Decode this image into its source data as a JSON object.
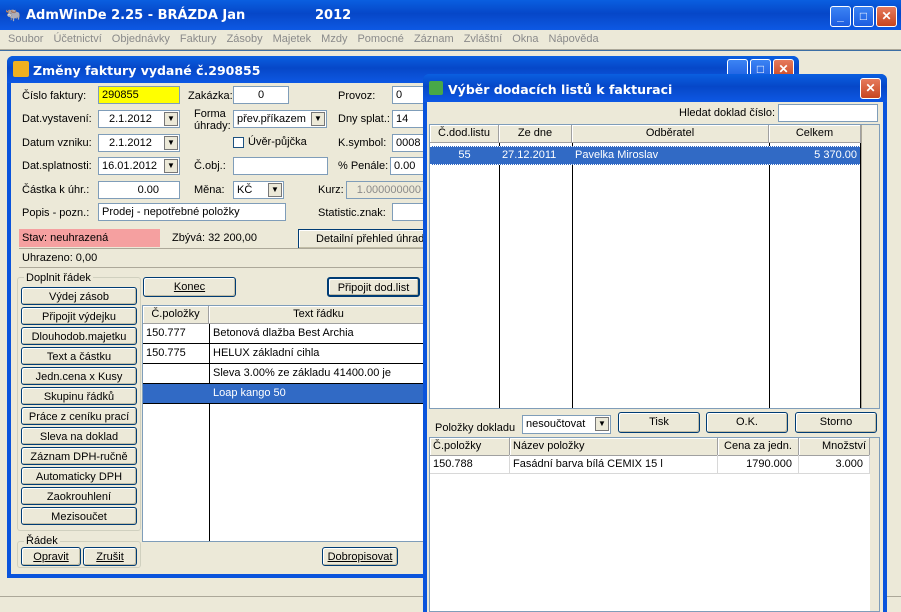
{
  "app": {
    "title": "AdmWinDe 2.25 - BRÁZDA Jan",
    "year": "2012"
  },
  "menu": [
    "Soubor",
    "Účetnictví",
    "Objednávky",
    "Faktury",
    "Zásoby",
    "Majetek",
    "Mzdy",
    "Pomocné",
    "Záznam",
    "Zvláštní",
    "Okna",
    "Nápověda"
  ],
  "invoice": {
    "title": "Změny faktury vydané č.290855",
    "cislo_label": "Číslo faktury:",
    "cislo": "290855",
    "zakazka_label": "Zakázka:",
    "zakazka": "0",
    "provoz_label": "Provoz:",
    "provoz": "0",
    "dat_vystaveni_label": "Dat.vystavení:",
    "dat_vystaveni": "2.1.2012",
    "forma_label1": "Forma",
    "forma_label2": "úhrady:",
    "forma": "přev.příkazem",
    "dny_label": "Dny splat.:",
    "dny": "14",
    "datum_vzniku_label": "Datum vzniku:",
    "datum_vzniku": "2.1.2012",
    "uver_label": "Úvěr-půjčka",
    "ksymbol_label": "K.symbol:",
    "ksymbol": "0008",
    "dat_splatnosti_label": "Dat.splatnosti:",
    "dat_splatnosti": "16.01.2012",
    "cobj_label": "Č.obj.:",
    "cobj": "",
    "penale_label": "% Penále:",
    "penale": "0.00",
    "castka_label": "Částka k úhr.:",
    "castka": "0.00",
    "mena_label": "Měna:",
    "mena": "KČ",
    "kurz_label": "Kurz:",
    "kurz": "1.000000000",
    "popis_label": "Popis - pozn.:",
    "popis": "Prodej - nepotřebné položky",
    "statistic_label": "Statistic.znak:",
    "statistic": "",
    "stav": "Stav: neuhrazená",
    "zbyva": "Zbývá: 32 200,00",
    "detail_btn": "Detailní přehled úhrad",
    "uhrazeno": "Uhrazeno: 0,00",
    "doplnit_title": "Doplnit řádek",
    "left_buttons": [
      "Výdej zásob",
      "Připojit výdejku",
      "Dlouhodob.majetku",
      "Text a částku",
      "Jedn.cena x Kusy",
      "Skupinu řádků",
      "Práce z ceníku prací",
      "Sleva na doklad",
      "Záznam DPH-ručně",
      "Automaticky DPH",
      "Zaokrouhlení",
      "Mezisoučet"
    ],
    "radek_title": "Řádek",
    "opravit": "Opravit",
    "zrusit": "Zrušit",
    "konec": "Konec",
    "pripojit_dl": "Připojit dod.list",
    "dobropisovat": "Dobropisovat",
    "grid_headers": [
      "Č.položky",
      "Text řádku"
    ],
    "grid_rows": [
      {
        "cislo": "150.777",
        "text": "Betonová dlažba Best Archia"
      },
      {
        "cislo": "150.775",
        "text": "HELUX základní cihla"
      },
      {
        "cislo": "",
        "text": "Sleva  3.00% ze základu  41400.00 je"
      },
      {
        "cislo": "",
        "text": "Loap kango 50"
      }
    ]
  },
  "dialog": {
    "title": "Výběr dodacích listů k fakturaci",
    "hledat_label": "Hledat doklad číslo:",
    "hledat": "",
    "headers": [
      "Č.dod.listu",
      "Ze dne",
      "Odběratel",
      "Celkem"
    ],
    "rows": [
      {
        "cislo": "55",
        "datum": "27.12.2011",
        "odberatel": "Pavelka Miroslav",
        "celkem": "5 370.00"
      }
    ],
    "polozky_label": "Položky dokladu",
    "polozky_sel": "nesoučtovat",
    "tisk": "Tisk",
    "ok": "O.K.",
    "storno": "Storno",
    "items_headers": [
      "Č.položky",
      "Název položky",
      "Cena za jedn.",
      "Množství"
    ],
    "items": [
      {
        "cislo": "150.788",
        "nazev": "Fasádní barva bílá CEMIX 15 l",
        "cena": "1790.000",
        "mnozstvi": "3.000"
      }
    ]
  }
}
